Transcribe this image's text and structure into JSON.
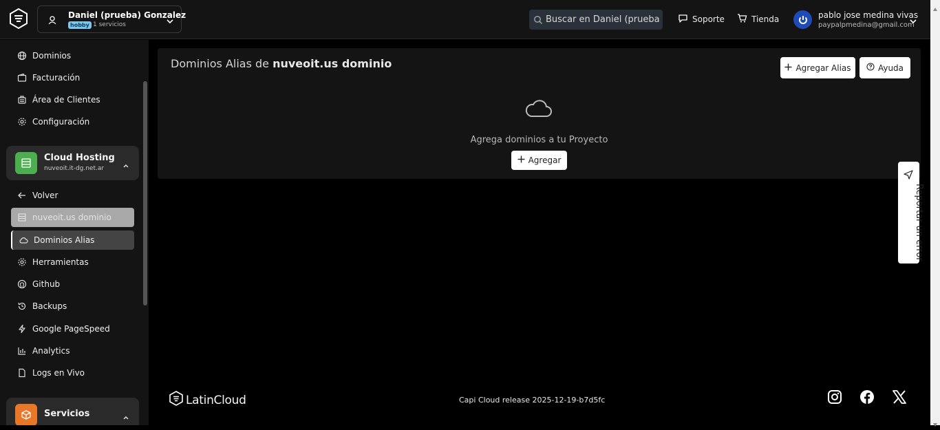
{
  "header": {
    "account": {
      "name": "Daniel (prueba) Gonzalez",
      "badge": "hobby",
      "services": "1 servicios"
    },
    "search": {
      "placeholder": "Buscar en Daniel (prueba) G"
    },
    "links": {
      "support": "Soporte",
      "store": "Tienda"
    },
    "user": {
      "name": "pablo jose medina vivas",
      "email": "paypalpmedina@gmail.com"
    }
  },
  "sidebar": {
    "top_items": [
      {
        "label": "Dominios",
        "icon": "globe-icon"
      },
      {
        "label": "Facturación",
        "icon": "wallet-icon"
      },
      {
        "label": "Área de Clientes",
        "icon": "customers-icon"
      },
      {
        "label": "Configuración",
        "icon": "gear-icon"
      }
    ],
    "cloud_group": {
      "title": "Cloud Hosting",
      "subtitle": "nuveoit.it-dg.net.ar",
      "color": "#4cae4f"
    },
    "cloud_items": [
      {
        "label": "Volver",
        "icon": "arrow-left-icon"
      },
      {
        "label": "nuveoit.us dominio",
        "icon": "server-icon",
        "state": "disabled"
      },
      {
        "label": "Dominios Alias",
        "icon": "cloud-icon",
        "state": "active"
      },
      {
        "label": "Herramientas",
        "icon": "gear-icon"
      },
      {
        "label": "Github",
        "icon": "github-icon"
      },
      {
        "label": "Backups",
        "icon": "history-icon"
      },
      {
        "label": "Google PageSpeed",
        "icon": "bolt-icon"
      },
      {
        "label": "Analytics",
        "icon": "chart-icon"
      },
      {
        "label": "Logs en Vivo",
        "icon": "file-icon"
      }
    ],
    "services_group": {
      "title": "Servicios",
      "color": "#e8772a"
    }
  },
  "main": {
    "title_prefix": "Dominios Alias de",
    "title_domain": "nuveoit.us dominio",
    "add_alias_label": "Agregar Alias",
    "help_label": "Ayuda",
    "empty_text": "Agrega dominios a tu Proyecto",
    "add_label": "Agregar"
  },
  "report_label": "Reportar un error",
  "footer": {
    "brand": "LatinCloud",
    "release": "Capi Cloud release 2025-12-19-b7d5fc"
  }
}
